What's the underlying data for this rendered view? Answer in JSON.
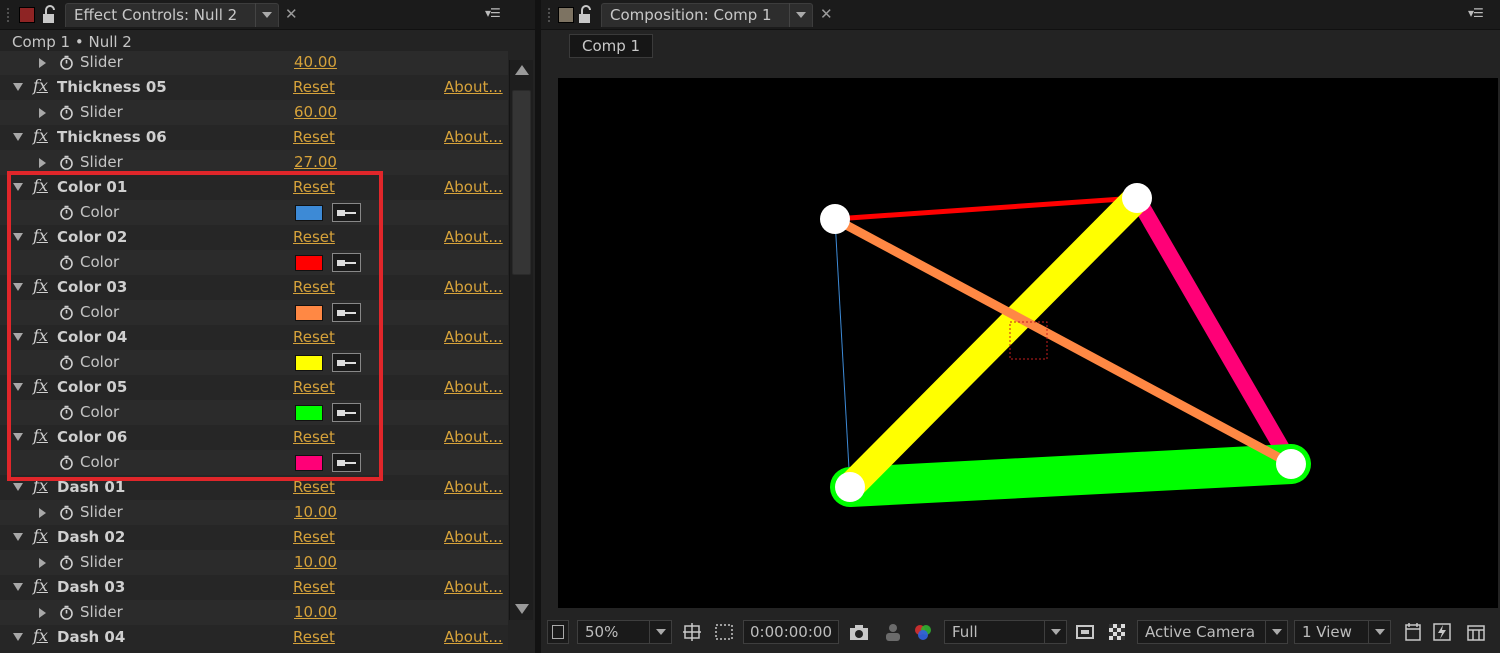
{
  "colors": {
    "accent_link": "#d6a23a",
    "highlight_box": "#e0262a",
    "effect_tab_swatch": "#8e2424",
    "comp_tab_swatch": "#7d7362"
  },
  "effect_panel": {
    "tab_label": "Effect Controls: Null 2",
    "breadcrumb": "Comp 1 • Null 2",
    "icons": [
      "grip-icon",
      "lock-icon",
      "tab-dropdown-icon",
      "close-icon",
      "panel-menu-icon"
    ]
  },
  "effects": [
    {
      "kind": "prop",
      "name": "Slider",
      "value": "40.00",
      "partial": true
    },
    {
      "kind": "effect",
      "name": "Thickness 05",
      "reset": "Reset",
      "about": "About..."
    },
    {
      "kind": "prop",
      "name": "Slider",
      "value": "60.00"
    },
    {
      "kind": "effect",
      "name": "Thickness 06",
      "reset": "Reset",
      "about": "About..."
    },
    {
      "kind": "prop",
      "name": "Slider",
      "value": "27.00"
    },
    {
      "kind": "effect",
      "name": "Color 01",
      "reset": "Reset",
      "about": "About..."
    },
    {
      "kind": "color",
      "name": "Color",
      "color": "#3d8ad6"
    },
    {
      "kind": "effect",
      "name": "Color 02",
      "reset": "Reset",
      "about": "About..."
    },
    {
      "kind": "color",
      "name": "Color",
      "color": "#ff0000"
    },
    {
      "kind": "effect",
      "name": "Color 03",
      "reset": "Reset",
      "about": "About..."
    },
    {
      "kind": "color",
      "name": "Color",
      "color": "#ff8844"
    },
    {
      "kind": "effect",
      "name": "Color 04",
      "reset": "Reset",
      "about": "About..."
    },
    {
      "kind": "color",
      "name": "Color",
      "color": "#ffff00"
    },
    {
      "kind": "effect",
      "name": "Color 05",
      "reset": "Reset",
      "about": "About..."
    },
    {
      "kind": "color",
      "name": "Color",
      "color": "#00ff00"
    },
    {
      "kind": "effect",
      "name": "Color 06",
      "reset": "Reset",
      "about": "About..."
    },
    {
      "kind": "color",
      "name": "Color",
      "color": "#ff0077"
    },
    {
      "kind": "effect",
      "name": "Dash 01",
      "reset": "Reset",
      "about": "About..."
    },
    {
      "kind": "prop",
      "name": "Slider",
      "value": "10.00"
    },
    {
      "kind": "effect",
      "name": "Dash 02",
      "reset": "Reset",
      "about": "About..."
    },
    {
      "kind": "prop",
      "name": "Slider",
      "value": "10.00"
    },
    {
      "kind": "effect",
      "name": "Dash 03",
      "reset": "Reset",
      "about": "About..."
    },
    {
      "kind": "prop",
      "name": "Slider",
      "value": "10.00"
    },
    {
      "kind": "effect",
      "name": "Dash 04",
      "reset": "Reset",
      "about": "About..."
    }
  ],
  "comp_panel": {
    "tab_label": "Composition: Comp 1",
    "flow_tab": "Comp 1",
    "toolbar": {
      "magnification": "50%",
      "timecode": "0:00:00:00",
      "resolution": "Full",
      "camera": "Active Camera",
      "views": "1 View"
    }
  },
  "canvas_shapes": {
    "lines": [
      {
        "name": "blue-line",
        "color": "#3d8ad6",
        "thickness": 1
      },
      {
        "name": "red-line",
        "color": "#ff0000",
        "thickness": 5
      },
      {
        "name": "orange-line",
        "color": "#ff8844",
        "thickness": 9
      },
      {
        "name": "yellow-line",
        "color": "#ffff00",
        "thickness": 28
      },
      {
        "name": "green-line",
        "color": "#00ff00",
        "thickness": 40
      },
      {
        "name": "pink-line",
        "color": "#ff0077",
        "thickness": 16
      }
    ]
  }
}
